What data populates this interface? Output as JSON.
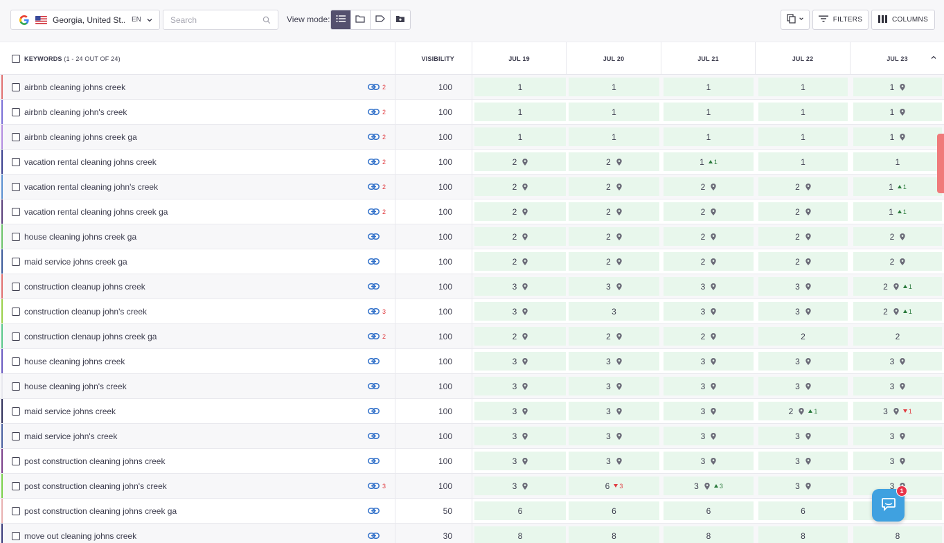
{
  "toolbar": {
    "location": "Georgia, United St...",
    "language": "EN",
    "search_placeholder": "Search",
    "view_mode_label": "View mode:",
    "view_modes": [
      "list-icon",
      "folder-icon",
      "tag-icon",
      "folder-image-icon"
    ],
    "filters_label": "FILTERS",
    "columns_label": "COLUMNS"
  },
  "table": {
    "keywords_label": "KEYWORDS",
    "keywords_count": "(1 - 24 OUT OF 24)",
    "visibility_label": "VISIBILITY",
    "dates": [
      "JUL 19",
      "JUL 20",
      "JUL 21",
      "JUL 22",
      "JUL 23"
    ],
    "rows": [
      {
        "keyword": "airbnb cleaning johns creek",
        "links": "2",
        "visibility": "100",
        "stripe": "#e07070",
        "ranks": [
          {
            "v": "1"
          },
          {
            "v": "1"
          },
          {
            "v": "1"
          },
          {
            "v": "1"
          },
          {
            "v": "1",
            "pin": true
          }
        ]
      },
      {
        "keyword": "airbnb cleaning john's creek",
        "links": "2",
        "visibility": "100",
        "stripe": "#7a6fd6",
        "ranks": [
          {
            "v": "1"
          },
          {
            "v": "1"
          },
          {
            "v": "1"
          },
          {
            "v": "1"
          },
          {
            "v": "1",
            "pin": true
          }
        ]
      },
      {
        "keyword": "airbnb cleaning johns creek ga",
        "links": "2",
        "visibility": "100",
        "stripe": "#b28ce0",
        "ranks": [
          {
            "v": "1"
          },
          {
            "v": "1"
          },
          {
            "v": "1"
          },
          {
            "v": "1"
          },
          {
            "v": "1",
            "pin": true
          }
        ]
      },
      {
        "keyword": "vacation rental cleaning johns creek",
        "links": "2",
        "visibility": "100",
        "stripe": "#3b3f8f",
        "ranks": [
          {
            "v": "2",
            "pin": true
          },
          {
            "v": "2",
            "pin": true
          },
          {
            "v": "1",
            "delta": "1",
            "dir": "up"
          },
          {
            "v": "1"
          },
          {
            "v": "1"
          }
        ]
      },
      {
        "keyword": "vacation rental cleaning john's creek",
        "links": "2",
        "visibility": "100",
        "stripe": "#5a8fd0",
        "ranks": [
          {
            "v": "2",
            "pin": true
          },
          {
            "v": "2",
            "pin": true
          },
          {
            "v": "2",
            "pin": true
          },
          {
            "v": "2",
            "pin": true
          },
          {
            "v": "1",
            "delta": "1",
            "dir": "up"
          }
        ]
      },
      {
        "keyword": "vacation rental cleaning johns creek ga",
        "links": "2",
        "visibility": "100",
        "stripe": "#5a3f7a",
        "ranks": [
          {
            "v": "2",
            "pin": true
          },
          {
            "v": "2",
            "pin": true
          },
          {
            "v": "2",
            "pin": true
          },
          {
            "v": "2",
            "pin": true
          },
          {
            "v": "1",
            "delta": "1",
            "dir": "up"
          }
        ]
      },
      {
        "keyword": "house cleaning johns creek ga",
        "links": "",
        "visibility": "100",
        "stripe": "#6cc36a",
        "ranks": [
          {
            "v": "2",
            "pin": true
          },
          {
            "v": "2",
            "pin": true
          },
          {
            "v": "2",
            "pin": true
          },
          {
            "v": "2",
            "pin": true
          },
          {
            "v": "2",
            "pin": true
          }
        ]
      },
      {
        "keyword": "maid service johns creek ga",
        "links": "",
        "visibility": "100",
        "stripe": "#3c5a9a",
        "ranks": [
          {
            "v": "2",
            "pin": true
          },
          {
            "v": "2",
            "pin": true
          },
          {
            "v": "2",
            "pin": true
          },
          {
            "v": "2",
            "pin": true
          },
          {
            "v": "2",
            "pin": true
          }
        ]
      },
      {
        "keyword": "construction cleanup johns creek",
        "links": "",
        "visibility": "100",
        "stripe": "#e06f6f",
        "ranks": [
          {
            "v": "3",
            "pin": true
          },
          {
            "v": "3",
            "pin": true
          },
          {
            "v": "3",
            "pin": true
          },
          {
            "v": "3",
            "pin": true
          },
          {
            "v": "2",
            "pin": true,
            "delta": "1",
            "dir": "up"
          }
        ]
      },
      {
        "keyword": "construction cleanup john's creek",
        "links": "3",
        "visibility": "100",
        "stripe": "#9ad04a",
        "ranks": [
          {
            "v": "3",
            "pin": true
          },
          {
            "v": "3"
          },
          {
            "v": "3",
            "pin": true
          },
          {
            "v": "3",
            "pin": true
          },
          {
            "v": "2",
            "pin": true,
            "delta": "1",
            "dir": "up"
          }
        ]
      },
      {
        "keyword": "construction clenaup johns creek ga",
        "links": "2",
        "visibility": "100",
        "stripe": "#5ac88a",
        "ranks": [
          {
            "v": "2",
            "pin": true
          },
          {
            "v": "2",
            "pin": true
          },
          {
            "v": "2",
            "pin": true
          },
          {
            "v": "2"
          },
          {
            "v": "2"
          }
        ]
      },
      {
        "keyword": "house cleaning johns creek",
        "links": "",
        "visibility": "100",
        "stripe": "#6a5ac0",
        "ranks": [
          {
            "v": "3",
            "pin": true
          },
          {
            "v": "3",
            "pin": true
          },
          {
            "v": "3",
            "pin": true
          },
          {
            "v": "3",
            "pin": true
          },
          {
            "v": "3",
            "pin": true
          }
        ]
      },
      {
        "keyword": "house cleaning john's creek",
        "links": "",
        "visibility": "100",
        "stripe": "#e8e8ee",
        "ranks": [
          {
            "v": "3",
            "pin": true
          },
          {
            "v": "3",
            "pin": true
          },
          {
            "v": "3",
            "pin": true
          },
          {
            "v": "3",
            "pin": true
          },
          {
            "v": "3",
            "pin": true
          }
        ]
      },
      {
        "keyword": "maid service johns creek",
        "links": "",
        "visibility": "100",
        "stripe": "#2f2f5a",
        "ranks": [
          {
            "v": "3",
            "pin": true
          },
          {
            "v": "3",
            "pin": true
          },
          {
            "v": "3",
            "pin": true
          },
          {
            "v": "2",
            "pin": true,
            "delta": "1",
            "dir": "up"
          },
          {
            "v": "3",
            "pin": true,
            "delta": "1",
            "dir": "down"
          }
        ]
      },
      {
        "keyword": "maid service john's creek",
        "links": "",
        "visibility": "100",
        "stripe": "#4a5fa0",
        "ranks": [
          {
            "v": "3",
            "pin": true
          },
          {
            "v": "3",
            "pin": true
          },
          {
            "v": "3",
            "pin": true
          },
          {
            "v": "3",
            "pin": true
          },
          {
            "v": "3",
            "pin": true
          }
        ]
      },
      {
        "keyword": "post construction cleaning johns creek",
        "links": "",
        "visibility": "100",
        "stripe": "#7a3f8a",
        "ranks": [
          {
            "v": "3",
            "pin": true
          },
          {
            "v": "3",
            "pin": true
          },
          {
            "v": "3",
            "pin": true
          },
          {
            "v": "3",
            "pin": true
          },
          {
            "v": "3",
            "pin": true
          }
        ]
      },
      {
        "keyword": "post construction cleaning john's creek",
        "links": "3",
        "visibility": "100",
        "stripe": "#7ad04a",
        "ranks": [
          {
            "v": "3",
            "pin": true
          },
          {
            "v": "6",
            "delta": "3",
            "dir": "down"
          },
          {
            "v": "3",
            "pin": true,
            "delta": "3",
            "dir": "up"
          },
          {
            "v": "3",
            "pin": true
          },
          {
            "v": "3",
            "pin": true
          }
        ]
      },
      {
        "keyword": "post construction cleaning johns creek ga",
        "links": "",
        "visibility": "50",
        "stripe": "#e8b0b0",
        "ranks": [
          {
            "v": "6"
          },
          {
            "v": "6"
          },
          {
            "v": "6"
          },
          {
            "v": "6"
          },
          {
            "v": ""
          }
        ]
      },
      {
        "keyword": "move out cleaning johns creek",
        "links": "",
        "visibility": "30",
        "stripe": "#3a3a7a",
        "ranks": [
          {
            "v": "8"
          },
          {
            "v": "8"
          },
          {
            "v": "8"
          },
          {
            "v": "8"
          },
          {
            "v": "8"
          }
        ]
      }
    ]
  },
  "chat": {
    "badge": "1"
  },
  "colors": {
    "rank_bg": "#e8f7ec",
    "link_blue": "#2f6fc9",
    "link_count_red": "#e0393e",
    "view_mode_active": "#54506e",
    "chat_blue": "#3fa1e0"
  }
}
